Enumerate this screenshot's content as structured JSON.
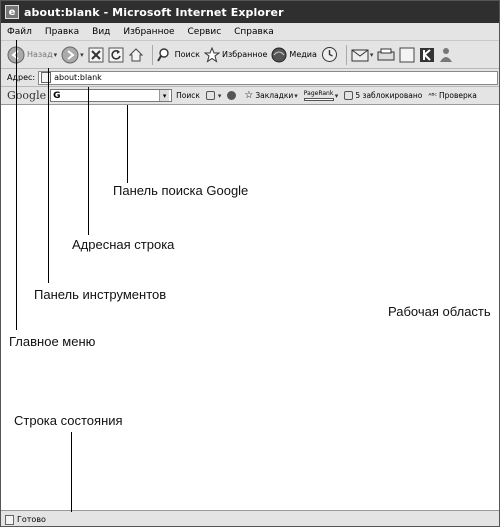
{
  "window": {
    "title": "about:blank - Microsoft Internet Explorer"
  },
  "menu": {
    "items": [
      "Файл",
      "Правка",
      "Вид",
      "Избранное",
      "Сервис",
      "Справка"
    ]
  },
  "toolbar": {
    "back": "Назад",
    "search": "Поиск",
    "favorites": "Избранное",
    "media": "Медиа"
  },
  "address": {
    "label": "Адрес:",
    "value": "about:blank"
  },
  "google_bar": {
    "logo": "Google",
    "field_mark": "G",
    "search": "Поиск",
    "bookmarks": "Закладки",
    "pagerank": "PageRank",
    "blocked": "5 заблокировано",
    "spellcheck": "Проверка"
  },
  "status": {
    "text": "Готово"
  },
  "annotations": {
    "google_bar": "Панель поиска Google",
    "address_bar": "Адресная строка",
    "toolbar": "Панель инструментов",
    "workspace": "Рабочая область",
    "main_menu": "Главное меню",
    "status_bar": "Строка состояния"
  },
  "colors": {
    "chrome": "#e4e4e4",
    "titlebar": "#2f2f2f"
  }
}
